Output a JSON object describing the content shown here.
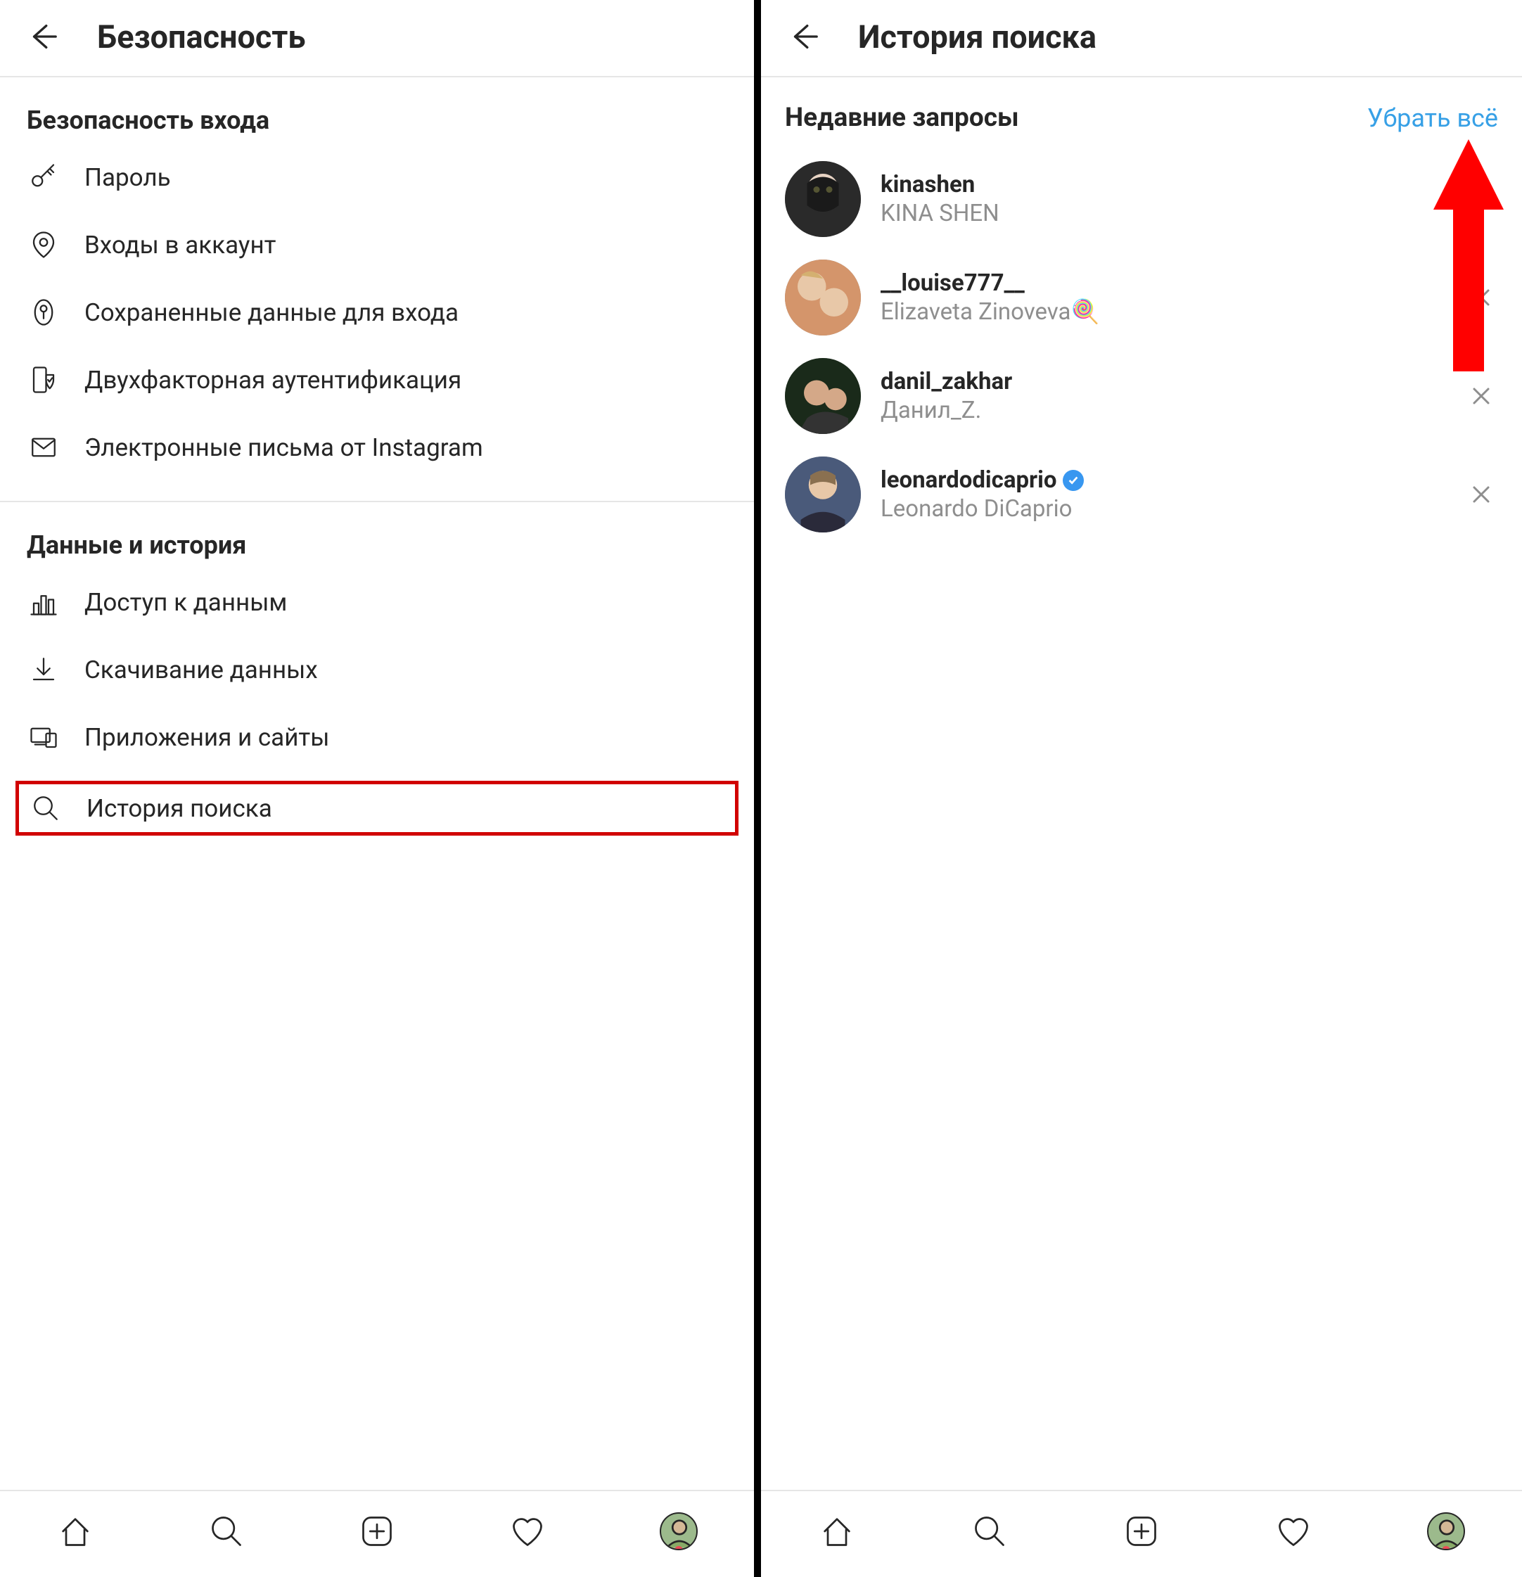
{
  "left": {
    "header": {
      "title": "Безопасность"
    },
    "section1_title": "Безопасность входа",
    "section2_title": "Данные и история",
    "items1": [
      {
        "label": "Пароль",
        "icon": "key"
      },
      {
        "label": "Входы в аккаунт",
        "icon": "location"
      },
      {
        "label": "Сохраненные данные для входа",
        "icon": "keyhole"
      },
      {
        "label": "Двухфакторная аутентификация",
        "icon": "shield-phone"
      },
      {
        "label": "Электронные письма от Instagram",
        "icon": "mail"
      }
    ],
    "items2": [
      {
        "label": "Доступ к данным",
        "icon": "chart"
      },
      {
        "label": "Скачивание данных",
        "icon": "download"
      },
      {
        "label": "Приложения и сайты",
        "icon": "devices"
      },
      {
        "label": "История поиска",
        "icon": "search",
        "highlighted": true
      }
    ]
  },
  "right": {
    "header": {
      "title": "История поиска"
    },
    "recent_title": "Недавние запросы",
    "clear_all": "Убрать всё",
    "users": [
      {
        "username": "kinashen",
        "display": "KINA SHEN",
        "verified": false
      },
      {
        "username": "__louise777__",
        "display": "Elizaveta Zinoveva🍭",
        "verified": false
      },
      {
        "username": "danil_zakhar",
        "display": "Данил_Z.",
        "verified": false
      },
      {
        "username": "leonardodicaprio",
        "display": "Leonardo DiCaprio",
        "verified": true
      }
    ]
  },
  "annotations": {
    "red_arrow_color": "#ff0000",
    "highlight_color": "#d10000",
    "link_color": "#37a0e6"
  }
}
